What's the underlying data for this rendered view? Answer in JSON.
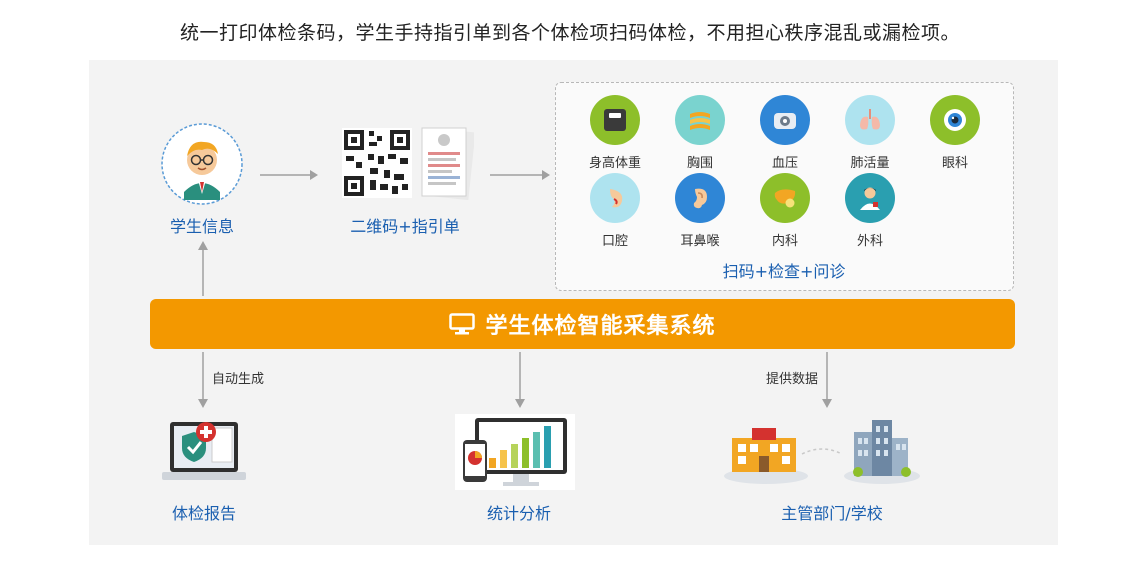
{
  "headline": "统一打印体检条码，学生手持指引单到各个体检项扫码体检，不用担心秩序混乱或漏检项。",
  "student": {
    "label": "学生信息"
  },
  "qr": {
    "label": "二维码+指引单"
  },
  "exams": {
    "items": [
      {
        "name": "身高体重",
        "icon": "scale-icon",
        "color": "#8dbf2a"
      },
      {
        "name": "胸围",
        "icon": "tape-measure-icon",
        "color": "#7ad3cf"
      },
      {
        "name": "血压",
        "icon": "blood-pressure-icon",
        "color": "#2f86d6"
      },
      {
        "name": "肺活量",
        "icon": "lungs-icon",
        "color": "#aee3ef"
      },
      {
        "name": "眼科",
        "icon": "eye-icon",
        "color": "#8dbf2a"
      },
      {
        "name": "口腔",
        "icon": "mouth-icon",
        "color": "#aee3ef"
      },
      {
        "name": "耳鼻喉",
        "icon": "ear-icon",
        "color": "#2f86d6"
      },
      {
        "name": "内科",
        "icon": "liver-icon",
        "color": "#8dbf2a"
      },
      {
        "name": "外科",
        "icon": "doctor-icon",
        "color": "#2a9fb0"
      }
    ],
    "caption": "扫码+检查+问诊"
  },
  "system": {
    "title": "学生体检智能采集系统",
    "color": "#f39800"
  },
  "flows": {
    "auto_generate": "自动生成",
    "provide_data": "提供数据"
  },
  "outputs": {
    "report": "体检报告",
    "stats": "统计分析",
    "authority": "主管部门/学校"
  }
}
